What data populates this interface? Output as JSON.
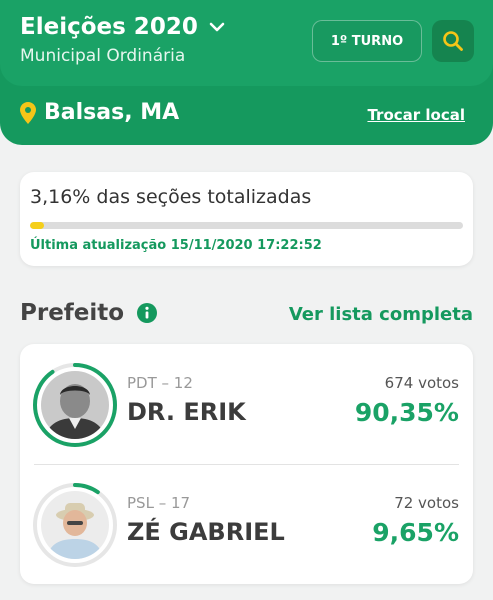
{
  "header": {
    "title": "Eleições 2020",
    "subtitle": "Municipal Ordinária",
    "turno_label": "1º TURNO",
    "location": "Balsas, MA",
    "change_location_label": "Trocar local"
  },
  "progress": {
    "text": "3,16% das seções totalizadas",
    "value_percent": 3.16,
    "updated": "Última atualização 15/11/2020 17:22:52"
  },
  "section": {
    "title": "Prefeito",
    "full_list_label": "Ver lista completa"
  },
  "candidates": [
    {
      "party": "PDT – 12",
      "name": "DR. ERIK",
      "votes": "674 votos",
      "percent": "90,35%",
      "percent_value": 90.35
    },
    {
      "party": "PSL – 17",
      "name": "ZÉ GABRIEL",
      "votes": "72 votos",
      "percent": "9,65%",
      "percent_value": 9.65
    }
  ],
  "colors": {
    "header_green": "#1aa266",
    "accent_green": "#15995e",
    "progress_yellow": "#f5cf1a",
    "pin_yellow": "#f5c518"
  },
  "icons": {
    "dropdown": "chevron-down-icon",
    "search": "search-icon",
    "location": "location-pin-icon",
    "info": "info-icon"
  }
}
